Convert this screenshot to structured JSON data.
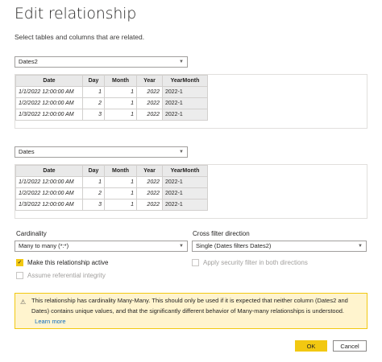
{
  "dialog": {
    "title": "Edit relationship",
    "subtitle": "Select tables and columns that are related."
  },
  "table1": {
    "selected": "Dates2",
    "columns": [
      "Date",
      "Day",
      "Month",
      "Year",
      "YearMonth"
    ],
    "rows": [
      [
        "1/1/2022 12:00:00 AM",
        "1",
        "1",
        "2022",
        "2022-1"
      ],
      [
        "1/2/2022 12:00:00 AM",
        "2",
        "1",
        "2022",
        "2022-1"
      ],
      [
        "1/3/2022 12:00:00 AM",
        "3",
        "1",
        "2022",
        "2022-1"
      ]
    ]
  },
  "table2": {
    "selected": "Dates",
    "columns": [
      "Date",
      "Day",
      "Month",
      "Year",
      "YearMonth"
    ],
    "rows": [
      [
        "1/1/2022 12:00:00 AM",
        "1",
        "1",
        "2022",
        "2022-1"
      ],
      [
        "1/2/2022 12:00:00 AM",
        "2",
        "1",
        "2022",
        "2022-1"
      ],
      [
        "1/3/2022 12:00:00 AM",
        "3",
        "1",
        "2022",
        "2022-1"
      ]
    ]
  },
  "cardinality": {
    "label": "Cardinality",
    "value": "Many to many (*:*)"
  },
  "cross_filter": {
    "label": "Cross filter direction",
    "value": "Single (Dates filters Dates2)"
  },
  "options": {
    "active_label": "Make this relationship active",
    "active_checked": true,
    "security_label": "Apply security filter in both directions",
    "integrity_label": "Assume referential integrity"
  },
  "warning": {
    "text": "This relationship has cardinality Many-Many. This should only be used if it is expected that neither column (Dates2 and Dates) contains unique values, and that the significantly different behavior of Many-many relationships is understood.",
    "link": "Learn more"
  },
  "buttons": {
    "ok": "OK",
    "cancel": "Cancel"
  },
  "colors": {
    "accent": "#f2c811",
    "warning_bg": "#fff4ce",
    "link": "#0f6cbd",
    "header_bg": "#e9e9e9"
  },
  "icons": {
    "dropdown": "chevron-down-icon",
    "warning": "warning-icon",
    "check": "checkmark-icon"
  }
}
